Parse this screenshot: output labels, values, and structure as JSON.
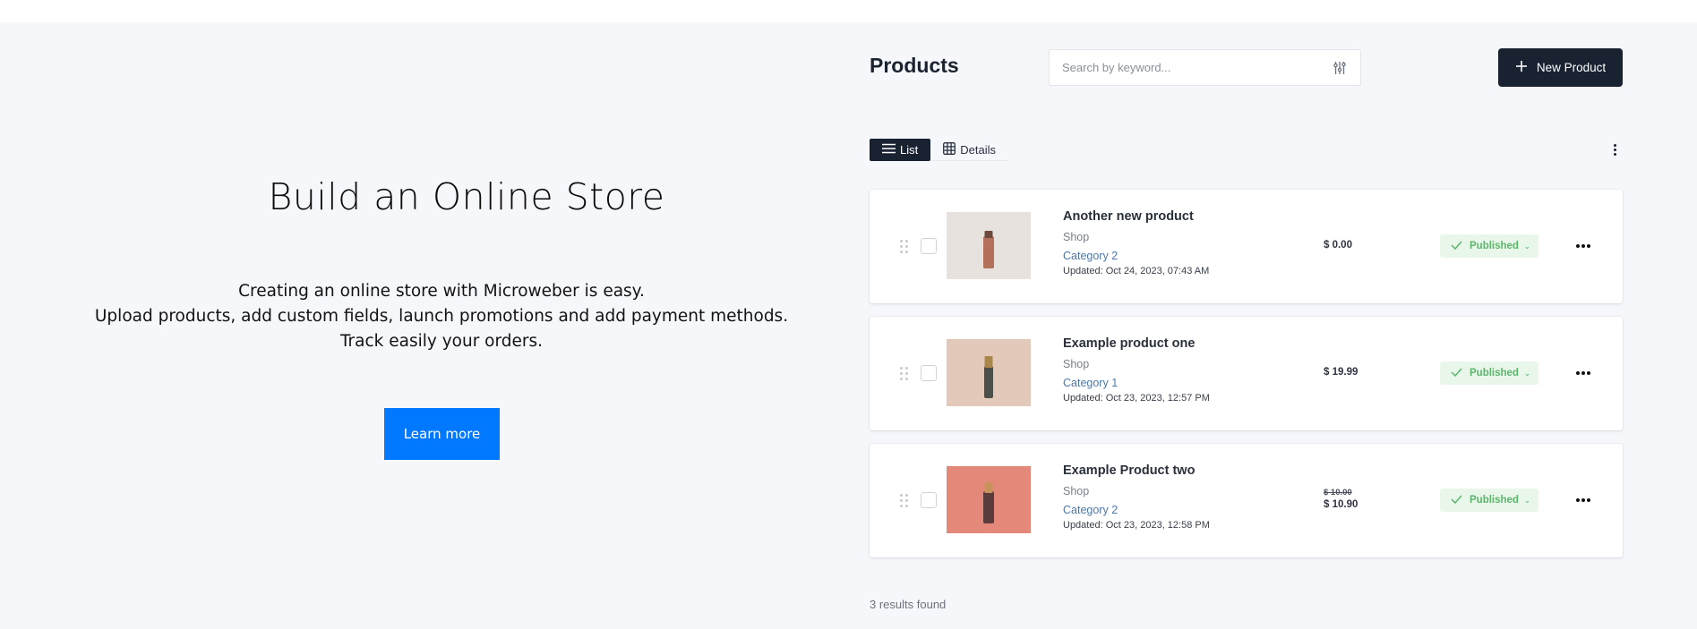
{
  "hero": {
    "title": "Build an Online Store",
    "lines": [
      "Creating an online store with Microweber is easy.",
      "Upload products, add custom fields, launch promotions and add payment methods.",
      "Track easily your orders."
    ],
    "button_label": "Learn more",
    "button_color": "#0078ff"
  },
  "products_panel": {
    "title": "Products",
    "search": {
      "placeholder": "Search by keyword...",
      "value": "",
      "filter_icon": "sliders-icon"
    },
    "new_button": {
      "label": "New Product",
      "icon": "plus-icon"
    },
    "view_tabs": [
      {
        "label": "List",
        "icon": "list-icon",
        "active": true
      },
      {
        "label": "Details",
        "icon": "grid-icon",
        "active": false
      }
    ],
    "options_icon": "vertical-dots-icon",
    "products": [
      {
        "name": "Another new product",
        "shop": "Shop",
        "category": "Category 2",
        "updated": "Updated: Oct 24, 2023, 07:43 AM",
        "price": "$ 0.00",
        "old_price": null,
        "status": "Published",
        "thumb_bg": "#e6e1dc",
        "bottle_color": "#b9735c"
      },
      {
        "name": "Example product one",
        "shop": "Shop",
        "category": "Category 1",
        "updated": "Updated: Oct 23, 2023, 12:57 PM",
        "price": "$ 19.99",
        "old_price": null,
        "status": "Published",
        "thumb_bg": "#e2c8b8",
        "bottle_color": "#4a4f48"
      },
      {
        "name": "Example Product two",
        "shop": "Shop",
        "category": "Category 2",
        "updated": "Updated: Oct 23, 2023, 12:58 PM",
        "price": "$ 10.90",
        "old_price": "$ 10.00",
        "status": "Published",
        "thumb_bg": "#e48878",
        "bottle_color": "#5b3a3c"
      }
    ],
    "results_text": "3 results found",
    "accent_dark": "#182231",
    "status_color": "#5db56c"
  }
}
